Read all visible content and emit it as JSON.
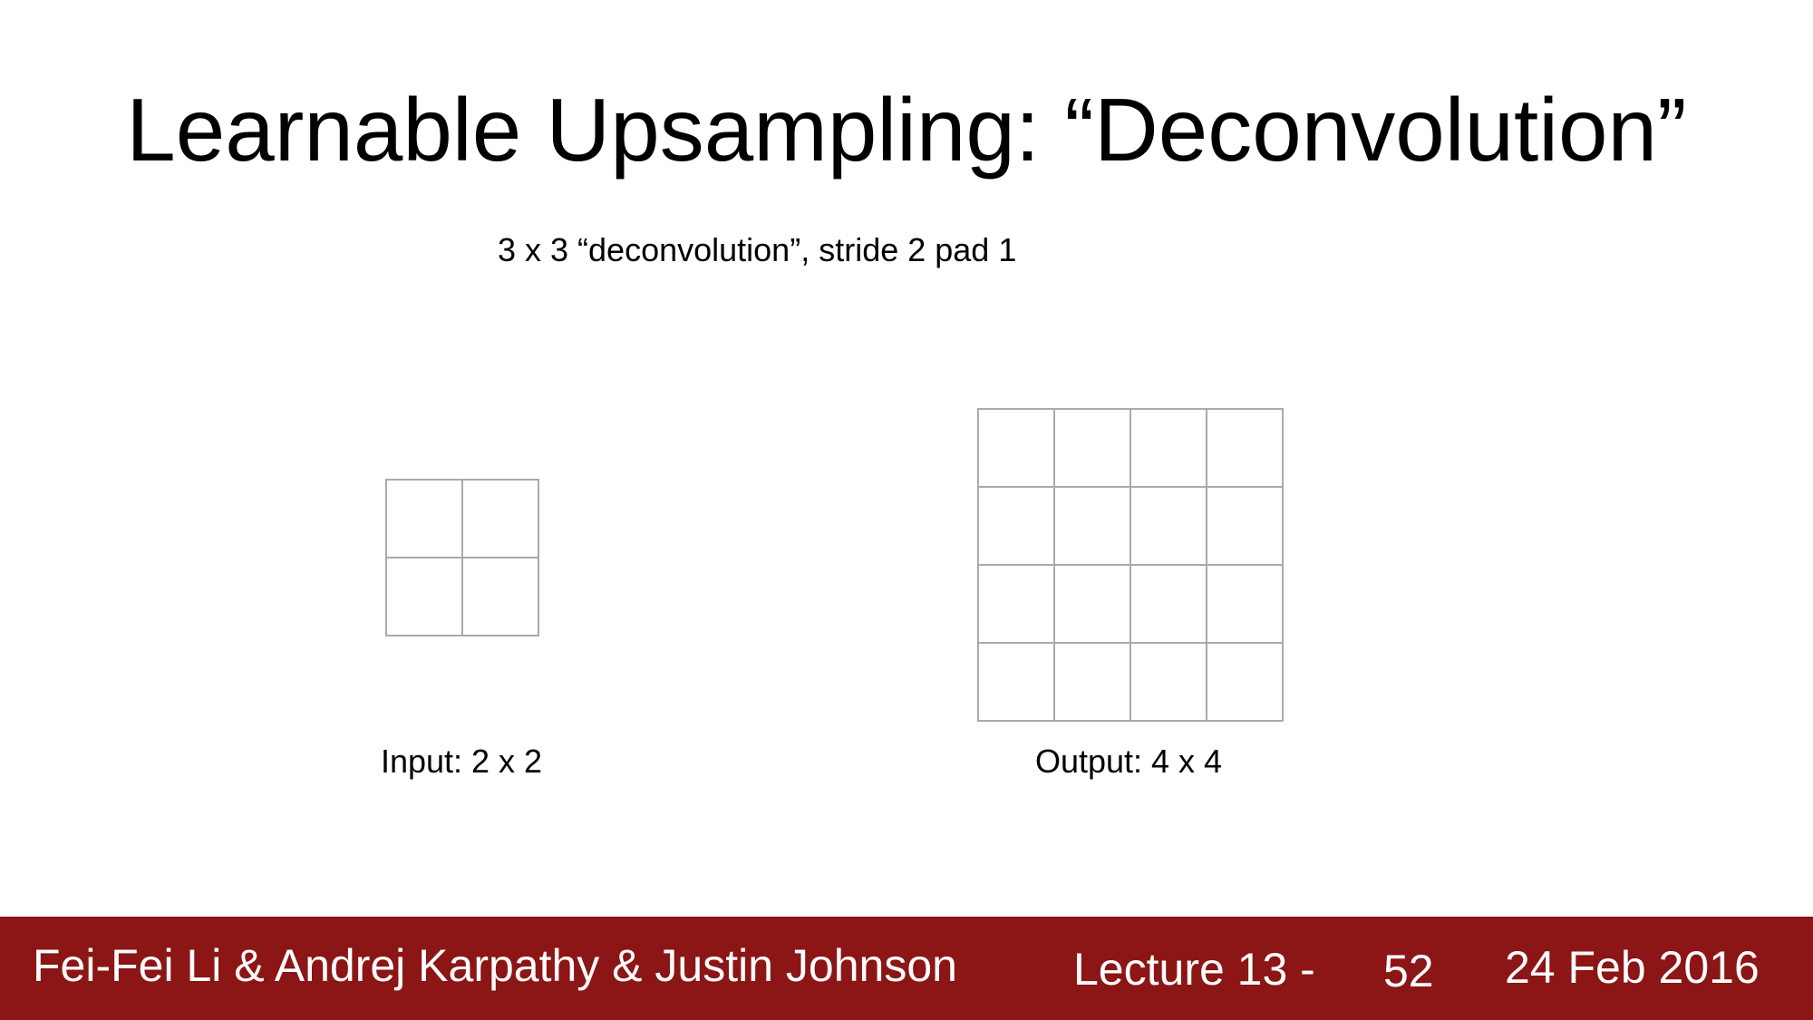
{
  "slide": {
    "title": "Learnable Upsampling: “Deconvolution”",
    "subtitle": "3 x 3 “deconvolution”, stride 2 pad 1"
  },
  "diagram": {
    "input": {
      "label": "Input: 2 x 2",
      "rows": 2,
      "cols": 2
    },
    "output": {
      "label": "Output: 4 x 4",
      "rows": 4,
      "cols": 4
    },
    "grid_line_color": "#aaaaaa"
  },
  "footer": {
    "authors": "Fei-Fei Li & Andrej Karpathy & Justin Johnson",
    "lecture": "Lecture 13 -",
    "page": "52",
    "date": "24 Feb 2016",
    "background_color": "#8c1515"
  }
}
